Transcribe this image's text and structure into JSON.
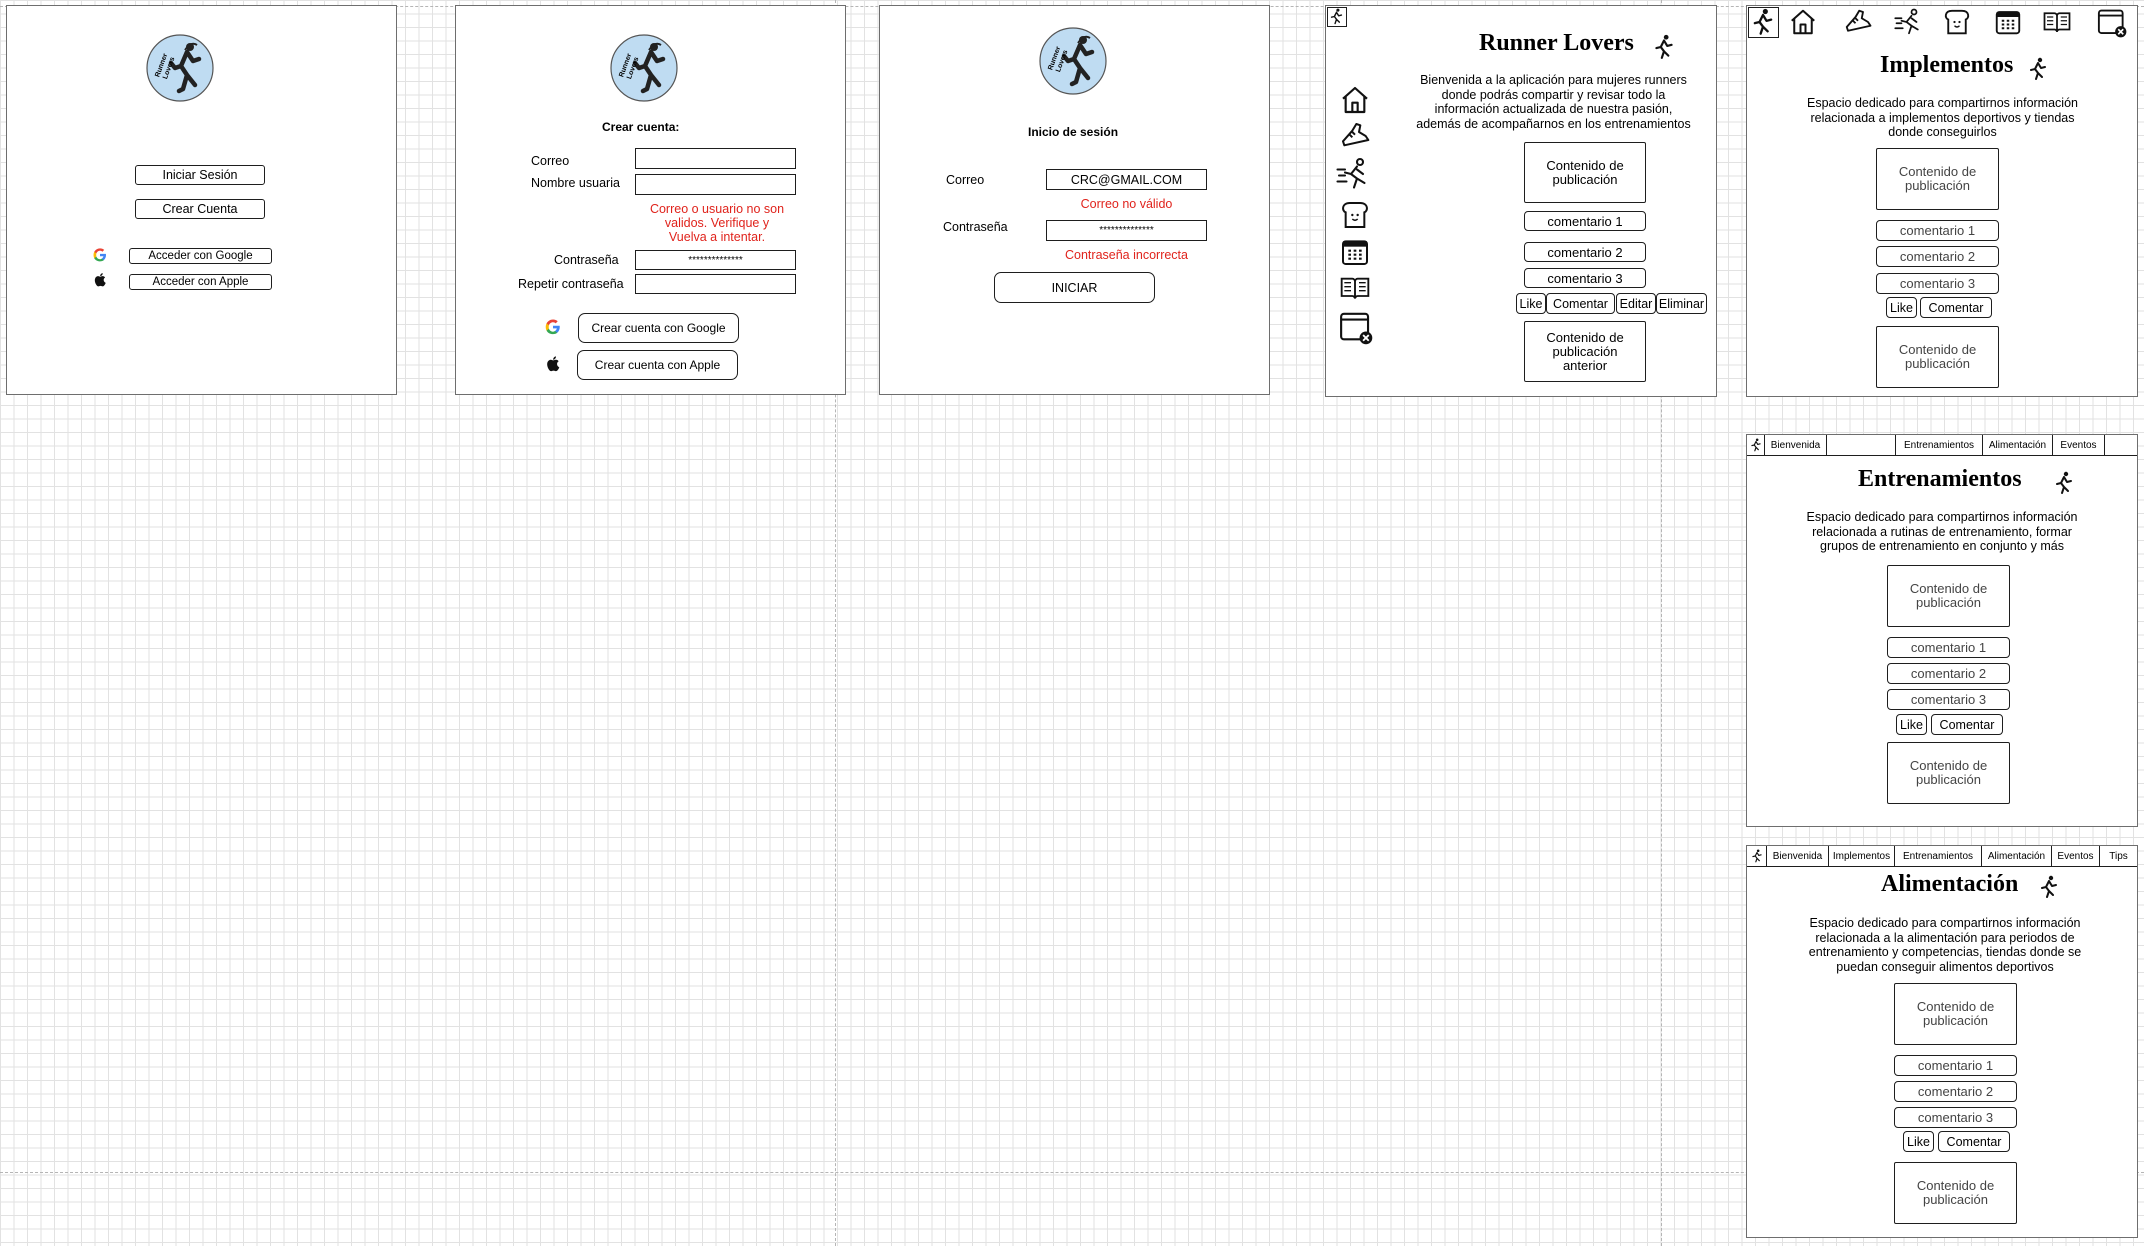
{
  "brand": {
    "logo_text": "Runner Lovers"
  },
  "screen_start": {
    "login_button": "Iniciar Sesión",
    "create_account_button": "Crear Cuenta",
    "google_button": "Acceder con Google",
    "apple_button": "Acceder con Apple"
  },
  "screen_register": {
    "title": "Crear cuenta:",
    "email_label": "Correo",
    "username_label": "Nombre usuaria",
    "error_text": "Correo o usuario no son validos. Verifique y Vuelva a intentar.",
    "password_label": "Contraseña",
    "password_value": "**************",
    "repeat_password_label": "Repetir contraseña",
    "google_button": "Crear cuenta con Google",
    "apple_button": "Crear cuenta con Apple"
  },
  "screen_login": {
    "title": "Inicio de sesión",
    "email_label": "Correo",
    "email_value": "CRC@GMAIL.COM",
    "email_error": "Correo no válido",
    "password_label": "Contraseña",
    "password_value": "**************",
    "password_error": "Contraseña incorrecta",
    "submit_button": "INICIAR"
  },
  "screen_welcome": {
    "title": "Runner Lovers",
    "description": "Bienvenida a la aplicación para mujeres runners donde podrás compartir y revisar todo la información actualizada de nuestra pasión, además de acompañarnos en los entrenamientos",
    "post": "Contenido de publicación",
    "comments": [
      "comentario 1",
      "comentario 2",
      "comentario 3"
    ],
    "actions": [
      "Like",
      "Comentar",
      "Editar",
      "Eliminar"
    ],
    "previous_post": "Contenido de publicación anterior"
  },
  "screen_implementos": {
    "title": "Implementos",
    "description": "Espacio dedicado para compartirnos información relacionada a implementos deportivos y tiendas donde conseguirlos",
    "post": "Contenido de publicación",
    "comments": [
      "comentario 1",
      "comentario 2",
      "comentario 3"
    ],
    "actions": [
      "Like",
      "Comentar"
    ],
    "post2": "Contenido de publicación"
  },
  "screen_entrenamientos": {
    "nav": [
      "Bienvenida",
      "Entrenamientos",
      "Alimentación",
      "Eventos"
    ],
    "title": "Entrenamientos",
    "description": "Espacio dedicado para compartirnos información relacionada a rutinas de entrenamiento, formar grupos de entrenamiento en conjunto y más",
    "post": "Contenido de publicación",
    "comments": [
      "comentario 1",
      "comentario 2",
      "comentario 3"
    ],
    "actions": [
      "Like",
      "Comentar"
    ],
    "post2": "Contenido de publicación"
  },
  "screen_alimentacion": {
    "nav": [
      "Bienvenida",
      "Implementos",
      "Entrenamientos",
      "Alimentación",
      "Eventos",
      "Tips"
    ],
    "title": "Alimentación",
    "description": "Espacio dedicado para compartirnos información relacionada a la alimentación para periodos de entrenamiento y competencias, tiendas donde se puedan conseguir alimentos deportivos",
    "post": "Contenido de publicación",
    "comments": [
      "comentario 1",
      "comentario 2",
      "comentario 3"
    ],
    "actions": [
      "Like",
      "Comentar"
    ],
    "post2": "Contenido de publicación"
  },
  "colors": {
    "error": "#e0231c",
    "logo_circle": "#bfdcf2",
    "frame_border": "#6e6e6e"
  },
  "icons": [
    "runner-icon",
    "home-icon",
    "shoe-icon",
    "sprint-icon",
    "bread-icon",
    "calendar-icon",
    "book-icon",
    "logout-window-icon",
    "google-icon",
    "apple-icon"
  ]
}
